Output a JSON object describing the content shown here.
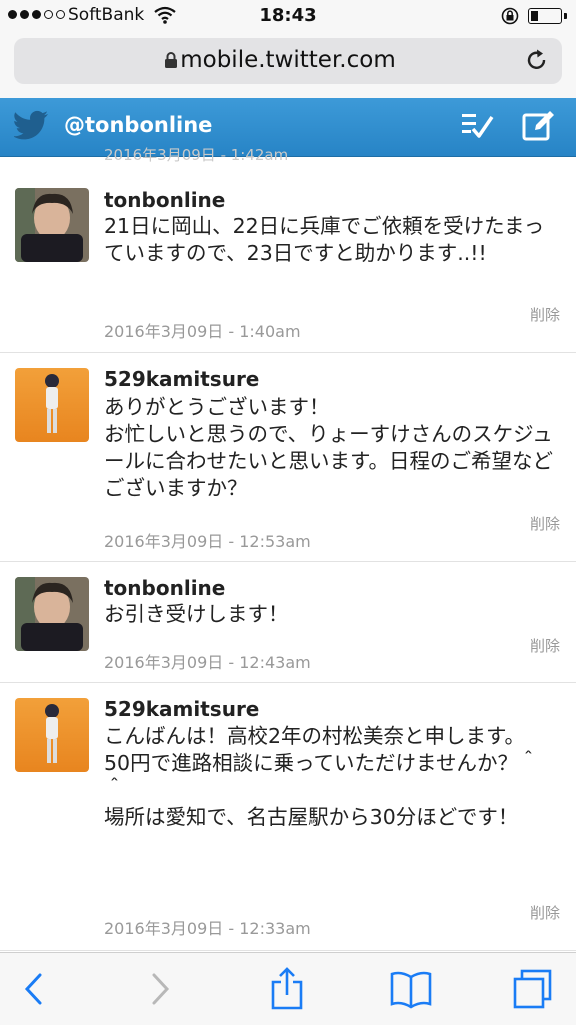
{
  "status_bar": {
    "carrier": "SoftBank",
    "time": "18:43",
    "signal_bars": 3,
    "signal_total": 5,
    "battery_level": 0.2
  },
  "browser": {
    "url": "mobile.twitter.com"
  },
  "twitter_header": {
    "handle": "@tonbonline",
    "icons": [
      "twitter-bird-icon",
      "checklist-icon",
      "compose-icon"
    ]
  },
  "partial_previous_timestamp": "2016年3月09日 - 1:42am",
  "tweets": [
    {
      "username": "tonbonline",
      "text": "21日に岡山、22日に兵庫でご依頼を受けたまっていますので、23日ですと助かります..!!",
      "timestamp": "2016年3月09日 - 1:40am",
      "delete_label": "削除"
    },
    {
      "username": "529kamitsure",
      "text": "ありがとうございます！\nお忙しいと思うので、りょーすけさんのスケジュールに合わせたいと思います。日程のご希望などございますか？",
      "timestamp": "2016年3月09日 - 12:53am",
      "delete_label": "削除"
    },
    {
      "username": "tonbonline",
      "text": "お引き受けします！",
      "timestamp": "2016年3月09日 - 12:43am",
      "delete_label": "削除"
    },
    {
      "username": "529kamitsure",
      "text": "こんばんは！高校2年の村松美奈と申します。\n50円で進路相談に乗っていただけませんか？＾＾\n場所は愛知で、名古屋駅から30分ほどです！",
      "timestamp": "2016年3月09日 - 12:33am",
      "delete_label": "削除"
    }
  ],
  "toolbar": {
    "icons": [
      "back-icon",
      "forward-icon",
      "share-icon",
      "bookmarks-icon",
      "tabs-icon"
    ]
  },
  "colors": {
    "header_blue": "#2f8ccf",
    "ios_blue": "#1a7cf5",
    "muted_text": "#999999"
  }
}
